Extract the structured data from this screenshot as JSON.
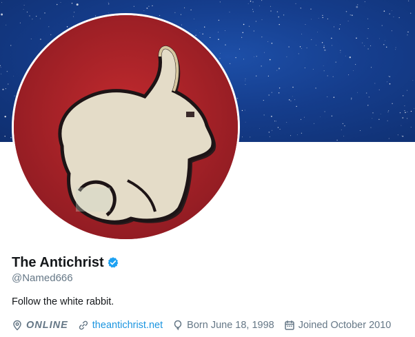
{
  "colors": {
    "banner": "#153d8c",
    "avatar_background": "#b0252a",
    "rabbit": "#e4dcc8",
    "verified": "#1da1f2",
    "link": "#1b95e0",
    "secondary_text": "#657786"
  },
  "banner": {
    "description_icon": "starfield-banner"
  },
  "avatar": {
    "icon": "white-rabbit-avatar"
  },
  "profile": {
    "display_name": "The Antichrist",
    "verified_icon": "verified-badge-icon",
    "handle": "@Named666",
    "bio": "Follow the white rabbit."
  },
  "meta": {
    "location": "ONLINE",
    "location_icon": "location-pin-icon",
    "website": "theantichrist.net",
    "website_icon": "link-icon",
    "birthday": "Born June 18, 1998",
    "birthday_icon": "balloon-icon",
    "joined": "Joined October 2010",
    "joined_icon": "calendar-icon"
  }
}
